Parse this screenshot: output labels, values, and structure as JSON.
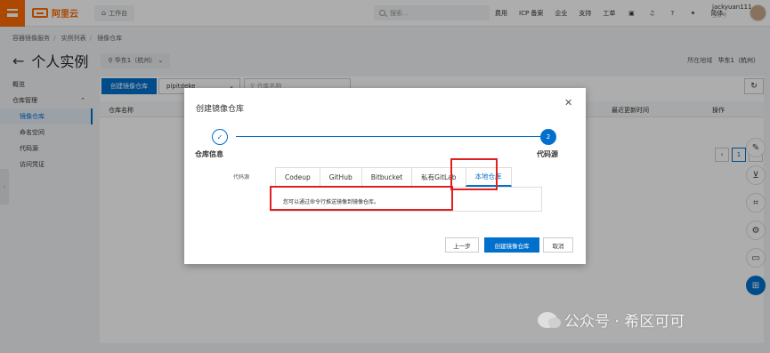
{
  "topbar": {
    "brand": "阿里云",
    "workbench": "工作台",
    "search_placeholder": "搜索...",
    "nav": [
      "费用",
      "ICP 备案",
      "企业",
      "支持",
      "工单"
    ],
    "lang": "简体",
    "username": "jackyuan111",
    "user_sub": "主账号"
  },
  "breadcrumb": [
    "容器镜像服务",
    "实例列表",
    "镜像仓库"
  ],
  "header": {
    "title": "个人实例",
    "region": "华东1（杭州）",
    "region_label": "所在地域",
    "region_value": "华东1（杭州）"
  },
  "sidebar": {
    "overview": "概览",
    "repo_mgmt": "仓库管理",
    "items": [
      "镜像仓库",
      "命名空间",
      "代码源",
      "访问凭证"
    ]
  },
  "main": {
    "create_button": "创建镜像仓库",
    "namespace": "pipitdeke",
    "name_placeholder": "仓库名称",
    "columns": [
      "仓库名称",
      "最近更新时间",
      "操作"
    ],
    "page": "1"
  },
  "dialog": {
    "title": "创建镜像仓库",
    "step1": "仓库信息",
    "step2": "代码源",
    "step2_num": "2",
    "source_label": "代码源",
    "tabs": [
      "Codeup",
      "GitHub",
      "Bitbucket",
      "私有GitLab",
      "本地仓库"
    ],
    "active_tab": "本地仓库",
    "tab_text": "您可以通过命令行推送镜像到镜像仓库。",
    "prev_button": "上一步",
    "create_button": "创建镜像仓库",
    "cancel_button": "取消"
  },
  "watermark": "公众号 · 希区可可"
}
